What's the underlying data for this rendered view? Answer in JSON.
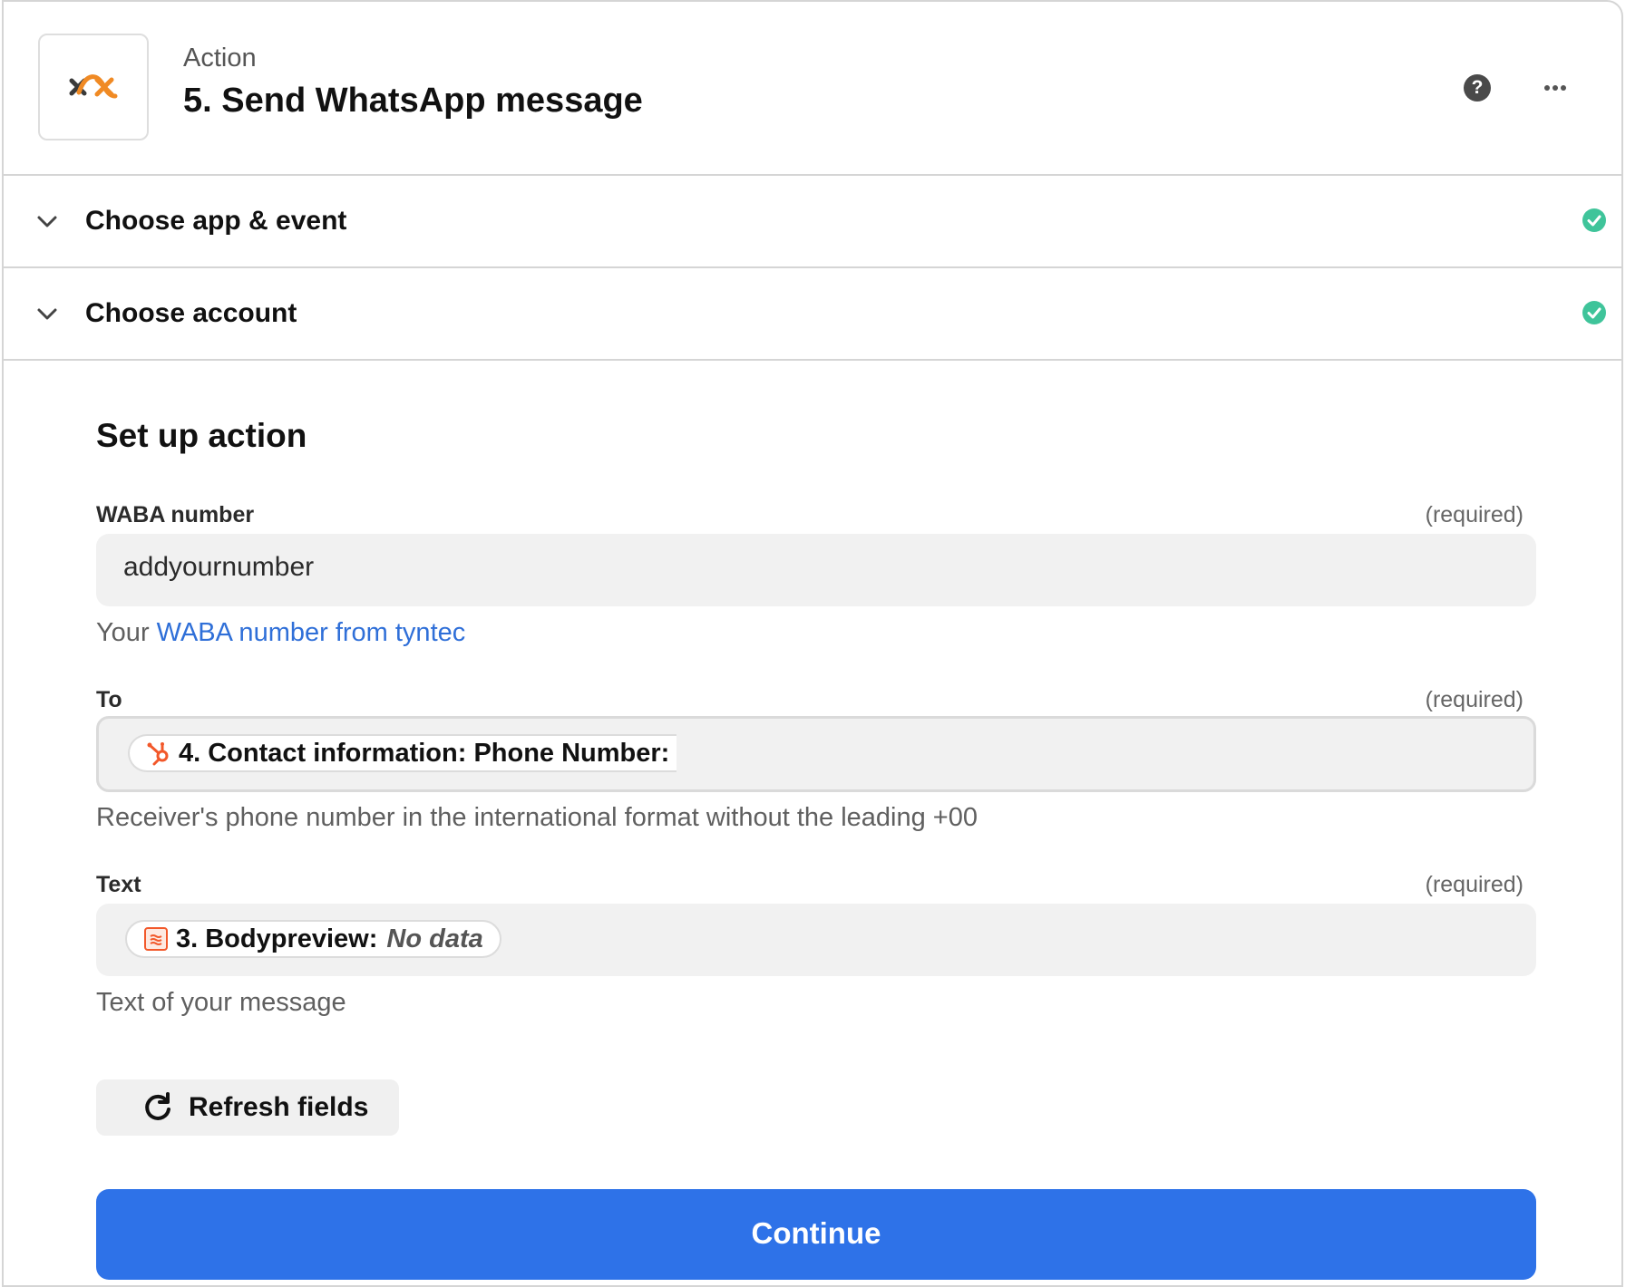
{
  "header": {
    "eyebrow": "Action",
    "title": "5. Send WhatsApp message",
    "help_symbol": "?",
    "more_symbol": "…"
  },
  "sections": [
    {
      "label": "Choose app & event",
      "status": "complete"
    },
    {
      "label": "Choose account",
      "status": "complete"
    }
  ],
  "setup": {
    "title": "Set up action",
    "fields": [
      {
        "label": "WABA number",
        "required_text": "(required)",
        "value": "addyournumber",
        "hint_prefix": "Your ",
        "hint_link": "WABA number from tyntec"
      },
      {
        "label": "To",
        "required_text": "(required)",
        "pill_app_icon": "hubspot-icon",
        "pill_step": "4. Contact information: Phone Number:",
        "hint": "Receiver's phone number in the international format without the leading +00"
      },
      {
        "label": "Text",
        "required_text": "(required)",
        "pill_app_icon": "email-parser-icon",
        "pill_step": "3. Bodypreview:",
        "pill_value": "No data",
        "hint": "Text of your message"
      }
    ],
    "refresh_label": "Refresh fields",
    "continue_label": "Continue"
  },
  "colors": {
    "accent_blue": "#2e72e8",
    "link_blue": "#2f6fd8",
    "check_green": "#3fc49a",
    "tyntec_orange": "#f08a24",
    "hubspot_orange": "#f2582a"
  }
}
